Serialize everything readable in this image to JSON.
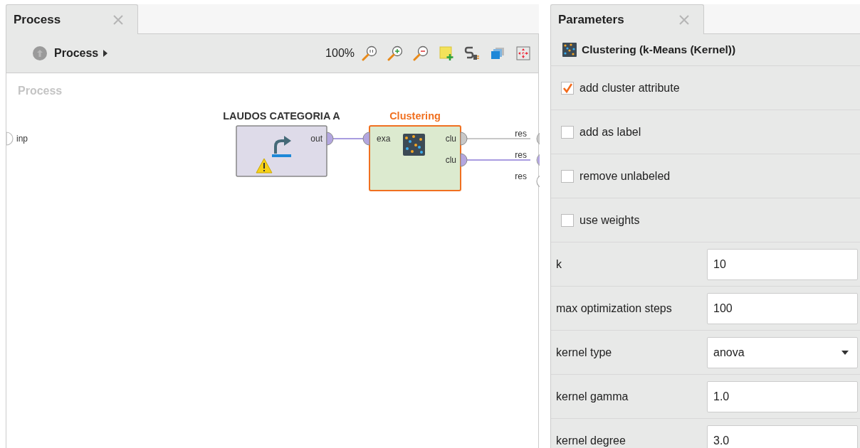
{
  "process_panel": {
    "tab": {
      "label": "Process",
      "selected": true
    },
    "breadcrumb": "Process",
    "zoom": "100%",
    "canvas": {
      "title": "Process",
      "inputs": [
        {
          "label": "inp",
          "kind": "empty"
        }
      ],
      "operators": [
        {
          "name": "LAUDOS CATEGORIA A",
          "kind": "retrieve",
          "warning": true,
          "selected": false,
          "outputs": [
            {
              "label": "out",
              "kind": "data",
              "connected": true
            }
          ]
        },
        {
          "name": "Clustering",
          "kind": "clustering",
          "warning": false,
          "selected": true,
          "inputs": [
            {
              "label": "exa",
              "kind": "data"
            }
          ],
          "outputs": [
            {
              "label": "clu",
              "kind": "model",
              "connected": true
            },
            {
              "label": "clu",
              "kind": "data",
              "connected": true
            }
          ]
        }
      ],
      "results": [
        {
          "label": "res",
          "kind": "model"
        },
        {
          "label": "res",
          "kind": "data"
        },
        {
          "label": "res",
          "kind": "empty"
        }
      ]
    }
  },
  "parameters_panel": {
    "tab": {
      "label": "Parameters",
      "selected": true
    },
    "operator": "Clustering (k-Means (Kernel))",
    "params": [
      {
        "kind": "checkbox",
        "label": "add cluster attribute",
        "checked": true
      },
      {
        "kind": "checkbox",
        "label": "add as label",
        "checked": false
      },
      {
        "kind": "checkbox",
        "label": "remove unlabeled",
        "checked": false
      },
      {
        "kind": "checkbox",
        "label": "use weights",
        "checked": false
      },
      {
        "kind": "text",
        "label": "k",
        "value": "10"
      },
      {
        "kind": "text",
        "label": "max optimization steps",
        "value": "100"
      },
      {
        "kind": "select",
        "label": "kernel type",
        "value": "anova"
      },
      {
        "kind": "text",
        "label": "kernel gamma",
        "value": "1.0"
      },
      {
        "kind": "text",
        "label": "kernel degree",
        "value": "3.0"
      }
    ]
  }
}
